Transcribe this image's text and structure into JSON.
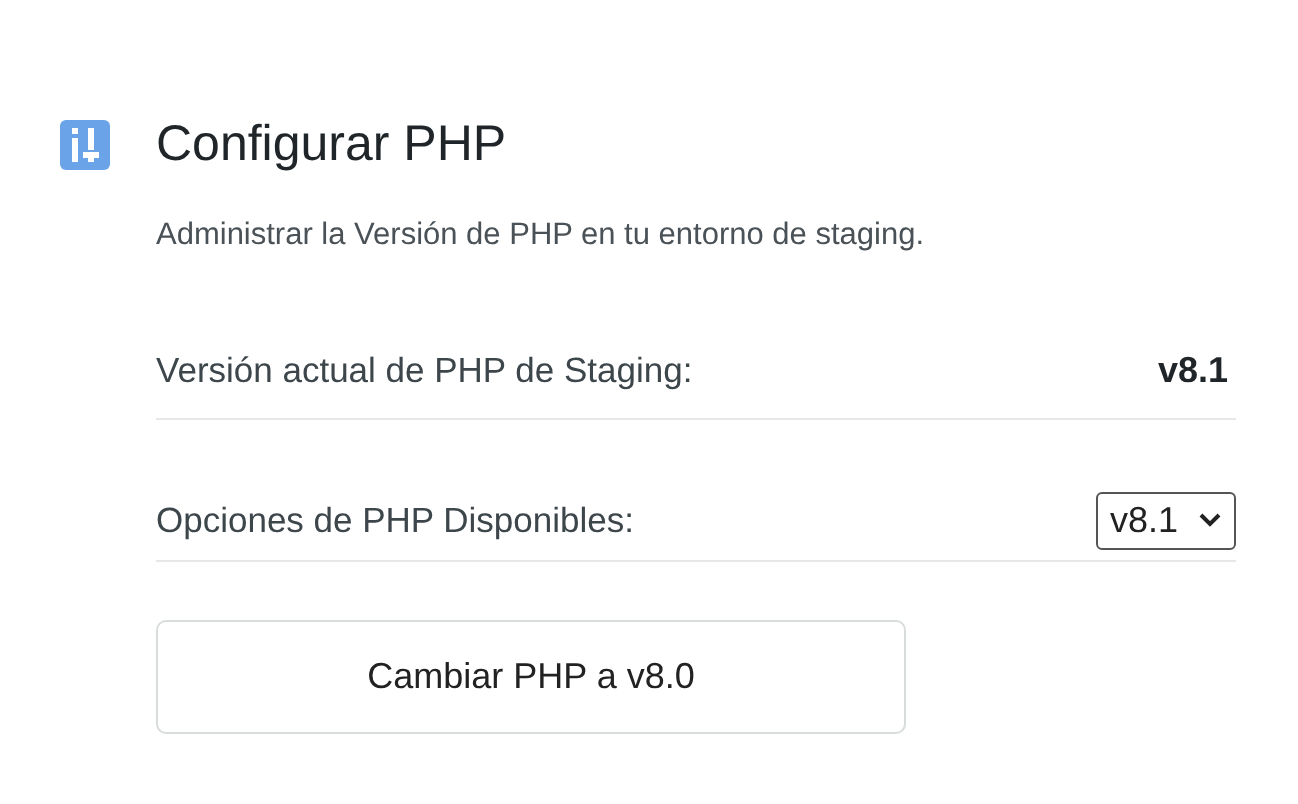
{
  "header": {
    "title": "Configurar PHP",
    "description": "Administrar la Versión de PHP en tu entorno de staging."
  },
  "current_version": {
    "label": "Versión actual de PHP de Staging:",
    "value": "v8.1"
  },
  "options": {
    "label": "Opciones de PHP Disponibles:",
    "selected_value": "v8.1"
  },
  "button": {
    "label": "Cambiar PHP a v8.0"
  }
}
